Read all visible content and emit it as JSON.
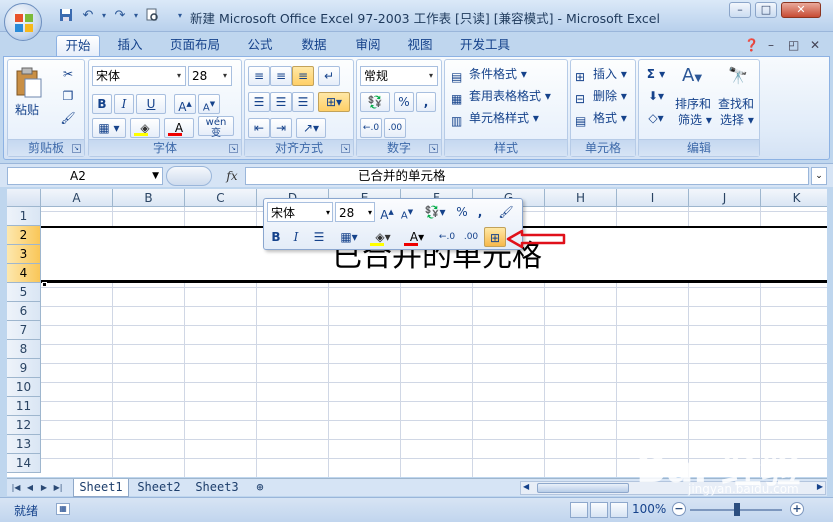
{
  "window": {
    "title": "新建 Microsoft Office Excel 97-2003 工作表  [只读]  [兼容模式] - Microsoft Excel",
    "controls": [
      "–",
      "□",
      "✕"
    ]
  },
  "quick_access": {
    "save": "save-icon",
    "undo": "undo-icon",
    "redo": "redo-icon",
    "preview": "print-preview-icon"
  },
  "ribbon": {
    "tabs": [
      "开始",
      "插入",
      "页面布局",
      "公式",
      "数据",
      "审阅",
      "视图",
      "开发工具"
    ],
    "active_tab": "开始",
    "clipboard": {
      "paste_label": "粘贴",
      "group_label": "剪贴板"
    },
    "font": {
      "font_name": "宋体",
      "font_size": "28",
      "bold": "B",
      "italic": "I",
      "underline": "U",
      "phonetic": "wén",
      "phonetic_char": "变",
      "group_label": "字体"
    },
    "alignment": {
      "group_label": "对齐方式"
    },
    "number": {
      "format": "常规",
      "percent": "%",
      "comma": ",",
      "group_label": "数字"
    },
    "styles": {
      "items": [
        "条件格式",
        "套用表格格式",
        "单元格样式"
      ],
      "group_label": "样式"
    },
    "cells": {
      "items": [
        "插入",
        "删除",
        "格式"
      ],
      "group_label": "单元格"
    },
    "editing": {
      "sigma": "Σ",
      "sort_label_1": "排序和",
      "sort_label_2": "筛选",
      "find_label_1": "查找和",
      "find_label_2": "选择",
      "group_label": "编辑"
    }
  },
  "formula_bar": {
    "name_box": "A2",
    "fx": "fx",
    "content": "已合并的单元格"
  },
  "grid": {
    "columns": [
      "A",
      "B",
      "C",
      "D",
      "E",
      "F",
      "G",
      "H",
      "I",
      "J",
      "K"
    ],
    "rows": [
      "1",
      "2",
      "3",
      "4",
      "5",
      "6",
      "7",
      "8",
      "9",
      "10",
      "11",
      "12",
      "13",
      "14"
    ],
    "selected_rows": [
      "2",
      "3",
      "4"
    ],
    "merged_text": "已合并的单元格"
  },
  "mini_toolbar": {
    "font_name": "宋体",
    "font_size": "28",
    "bold": "B",
    "italic": "I",
    "percent": "%",
    "comma": ","
  },
  "sheets": {
    "tabs": [
      "Sheet1",
      "Sheet2",
      "Sheet3"
    ],
    "active": "Sheet1"
  },
  "status": {
    "ready": "就绪",
    "zoom": "100%"
  },
  "watermark": {
    "text": "Bai 经验",
    "url": "jingyan.baidu.com"
  },
  "colors": {
    "accent": "#15428b",
    "merge_highlight": "#f7b84b",
    "annotation_arrow": "#e0101a"
  }
}
